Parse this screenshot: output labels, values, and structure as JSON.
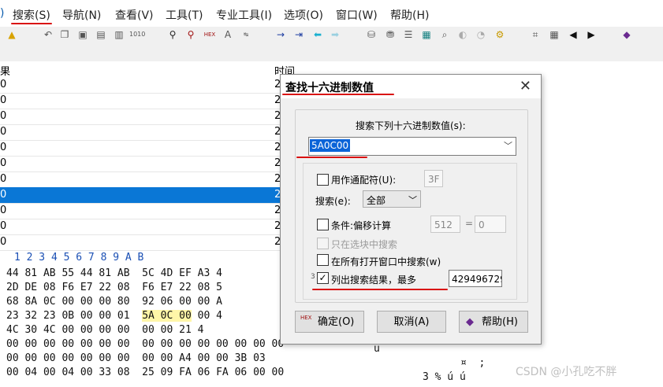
{
  "menubar": {
    "items": [
      "搜索(S)",
      "导航(N)",
      "查看(V)",
      "工具(T)",
      "专业工具(I)",
      "选项(O)",
      "窗口(W)",
      "帮助(H)"
    ]
  },
  "toolbar": {
    "icons": [
      "new-icon",
      "undo-icon",
      "copy-icon",
      "paste-icon",
      "paste-special-icon",
      "copy-hex-icon",
      "binary-icon",
      "find-icon",
      "find-replace-icon",
      "find-hex-icon",
      "find-text-icon",
      "replace-hex-icon",
      "goto-icon",
      "goto-offset-icon",
      "back-icon",
      "forward-icon",
      "disk-icon",
      "disk-edit-icon",
      "ram-icon",
      "calculator-icon",
      "search-icon",
      "lens-icon",
      "chart-icon",
      "gear-icon",
      "grid-icon",
      "table-icon",
      "prev-icon",
      "next-icon",
      "book-icon"
    ],
    "glyphs": {
      "find_hex": "HEX"
    }
  },
  "results": {
    "col_left": "果",
    "col_time": "时间",
    "rows": [
      {
        "left": "0",
        "time": "2"
      },
      {
        "left": "0",
        "time": "2"
      },
      {
        "left": "0",
        "time": "2"
      },
      {
        "left": "0",
        "time": "2"
      },
      {
        "left": "0",
        "time": "2"
      },
      {
        "left": "0",
        "time": "2"
      },
      {
        "left": "0",
        "time": "2"
      },
      {
        "left": "0",
        "time": "2"
      },
      {
        "left": "0",
        "time": "2"
      },
      {
        "left": "0",
        "time": "2"
      },
      {
        "left": "0",
        "time": "2"
      }
    ],
    "selected_index": 7
  },
  "hex": {
    "header": "1  2  3  4  5  6  7   8  9  A  B",
    "rows": [
      "44 81 AB 55 44 81 AB  5C 4D EF A3 4",
      "2D DE 08 F6 E7 22 08  F6 E7 22 08 5",
      "68 8A 0C 00 00 00 80  92 06 00 00 A",
      "23 32 23 0B 00 00 01  ",
      "4C 30 4C 00 00 00 00  00 00 21 4",
      "00 00 00 00 00 00 00  00 00 00 00 00 00 00 00",
      "00 00 00 00 00 00 00  00 00 A4 00 00 3B 03",
      "00 04 00 04 00 33 08  25 09 FA 06 FA 06 00 00"
    ],
    "highlight": "5A 0C 00",
    "row3_tail": " 00 4",
    "text_col": [
      "u",
      "¤  ;",
      "3 % ú ú"
    ]
  },
  "watermark": "CSDN @小孔吃不胖",
  "dialog": {
    "title": "查找十六进制数值",
    "close": "✕",
    "search_label": "搜索下列十六进制数值(s):",
    "search_value": "5A0C00",
    "wildcard_label": "用作通配符(U):",
    "wildcard_value": "3F",
    "search_dir_label": "搜索(e):",
    "search_dir_value": "全部",
    "condition_label": "条件:偏移计算",
    "offset_value": "512",
    "equals": "=",
    "offset_result": "0",
    "only_selection_label": "只在选块中搜索",
    "all_windows_label": "在所有打开窗口中搜索(w)",
    "list_results_label": "列出搜索结果，最多",
    "list_prefix": "3",
    "max_value": "429496729",
    "ok_label": "确定(O)",
    "cancel_label": "取消(A)",
    "help_label": "帮助(H)",
    "hex_badge": "HEX"
  },
  "colors": {
    "accent": "#0a77d6",
    "annotation": "#d91010",
    "highlight": "#fff6a8"
  }
}
